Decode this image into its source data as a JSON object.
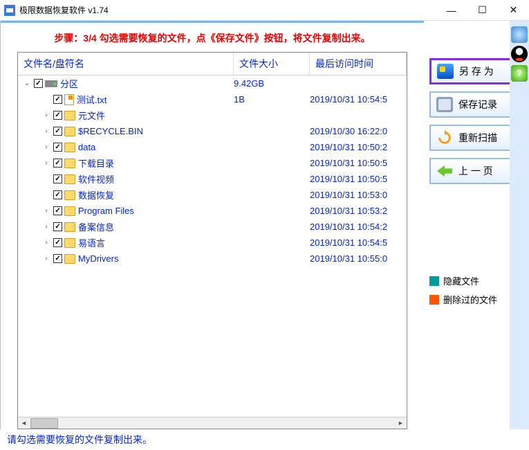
{
  "window": {
    "title": "极限数据恢复软件 v1.74"
  },
  "step_text": "步骤：3/4 勾选需要恢复的文件，点《保存文件》按钮，将文件复制出来。",
  "columns": {
    "name": "文件名/盘符名",
    "size": "文件大小",
    "time": "最后访问时间"
  },
  "rows": [
    {
      "depth": 0,
      "exp": "v",
      "chk": true,
      "icon": "disk",
      "name": "分区",
      "size": "9.42GB",
      "time": ""
    },
    {
      "depth": 1,
      "exp": "",
      "chk": true,
      "icon": "file",
      "name": "测试.txt",
      "size": "1B",
      "time": "2019/10/31 10:54:5"
    },
    {
      "depth": 1,
      "exp": ">",
      "chk": true,
      "icon": "folder",
      "name": "元文件",
      "size": "",
      "time": ""
    },
    {
      "depth": 1,
      "exp": ">",
      "chk": true,
      "icon": "folder",
      "name": "$RECYCLE.BIN",
      "size": "",
      "time": "2019/10/30 16:22:0"
    },
    {
      "depth": 1,
      "exp": ">",
      "chk": true,
      "icon": "folder",
      "name": "data",
      "size": "",
      "time": "2019/10/31 10:50:2"
    },
    {
      "depth": 1,
      "exp": ">",
      "chk": true,
      "icon": "folder",
      "name": "下载目录",
      "size": "",
      "time": "2019/10/31 10:50:5"
    },
    {
      "depth": 1,
      "exp": "",
      "chk": true,
      "icon": "folder",
      "name": "软件视频",
      "size": "",
      "time": "2019/10/31 10:50:5"
    },
    {
      "depth": 1,
      "exp": "",
      "chk": true,
      "icon": "folder",
      "name": "数据恢复",
      "size": "",
      "time": "2019/10/31 10:53:0"
    },
    {
      "depth": 1,
      "exp": ">",
      "chk": true,
      "icon": "folder",
      "name": "Program Files",
      "size": "",
      "time": "2019/10/31 10:53:2"
    },
    {
      "depth": 1,
      "exp": ">",
      "chk": true,
      "icon": "folder",
      "name": "备案信息",
      "size": "",
      "time": "2019/10/31 10:54:2"
    },
    {
      "depth": 1,
      "exp": ">",
      "chk": true,
      "icon": "folder",
      "name": "易语言",
      "size": "",
      "time": "2019/10/31 10:54:5"
    },
    {
      "depth": 1,
      "exp": ">",
      "chk": true,
      "icon": "folder",
      "name": "MyDrivers",
      "size": "",
      "time": "2019/10/31 10:55:0"
    }
  ],
  "buttons": {
    "save_as": "另 存 为",
    "save_log": "保存记录",
    "rescan": "重新扫描",
    "back": "上 一 页"
  },
  "legend": {
    "hidden": "隐藏文件",
    "deleted": "删除过的文件"
  },
  "status": "请勾选需要恢复的文件复制出来。"
}
